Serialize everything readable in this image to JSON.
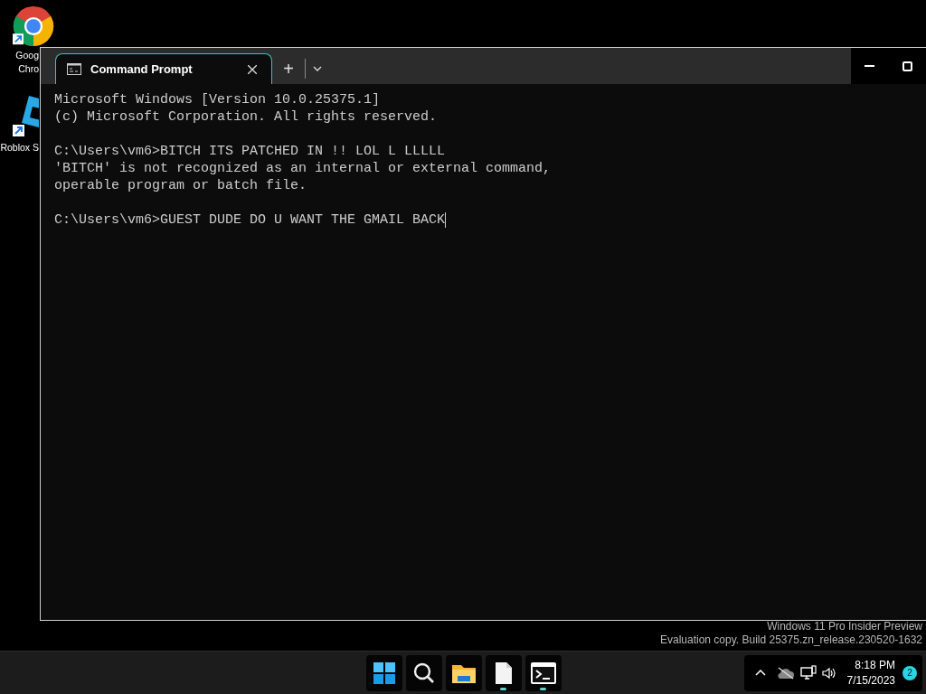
{
  "desktop_icons": [
    {
      "kind": "chrome",
      "label_lines": [
        "Goog",
        "Chro"
      ]
    },
    {
      "kind": "roblox",
      "label_lines": [
        "Roblox S"
      ]
    }
  ],
  "window": {
    "tabs": [
      {
        "title": "Command Prompt",
        "selected": true
      }
    ],
    "new_tab": "+",
    "terminal_blocks": [
      [
        "Microsoft Windows [Version 10.0.25375.1]",
        "(c) Microsoft Corporation. All rights reserved."
      ],
      [
        "C:\\Users\\vm6>BITCH ITS PATCHED IN !! LOL L LLLLL",
        "'BITCH' is not recognized as an internal or external command,",
        "operable program or batch file."
      ],
      [
        "C:\\Users\\vm6>GUEST DUDE DO U WANT THE GMAIL BACK"
      ]
    ],
    "cursor_visible": true
  },
  "watermark_lines": [
    "Windows 11 Pro Insider Preview",
    "Evaluation copy. Build 25375.zn_release.230520-1632"
  ],
  "taskbar": {
    "apps": [
      {
        "kind": "start",
        "running": false
      },
      {
        "kind": "search",
        "running": false
      },
      {
        "kind": "explorer",
        "running": false
      },
      {
        "kind": "notepad",
        "running": true
      },
      {
        "kind": "terminal",
        "running": true
      }
    ],
    "time": "8:18 PM",
    "date": "7/15/2023",
    "notification_count": "2"
  }
}
